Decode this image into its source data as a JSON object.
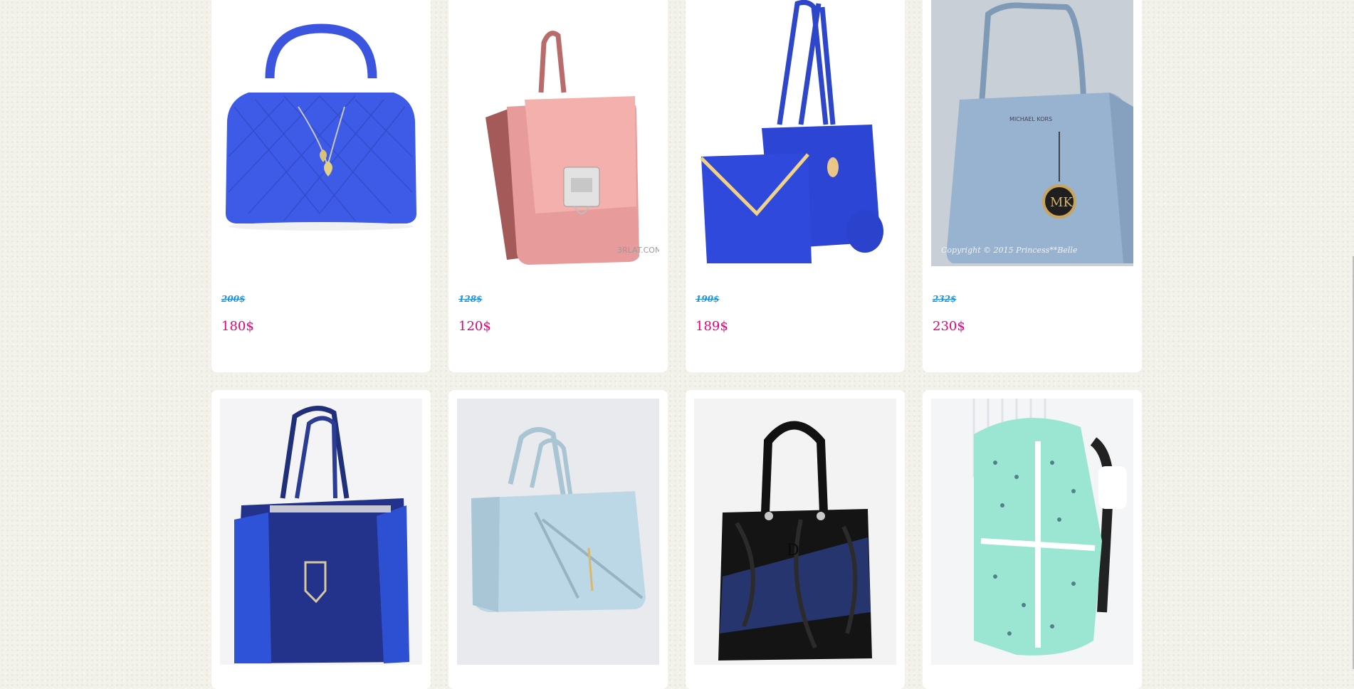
{
  "products": [
    {
      "old_price": "200$",
      "new_price": "180$",
      "image": "blue-quilted-bag"
    },
    {
      "old_price": "128$",
      "new_price": "120$",
      "image": "pink-patent-bag"
    },
    {
      "old_price": "190$",
      "new_price": "189$",
      "image": "blue-tote-set"
    },
    {
      "old_price": "232$",
      "new_price": "230$",
      "image": "light-blue-mk-bag"
    },
    {
      "image": "navy-tote-bag"
    },
    {
      "image": "light-blue-tote-bag"
    },
    {
      "image": "black-croc-bag"
    },
    {
      "image": "mint-backpack"
    }
  ],
  "watermarks": {
    "p2": "3RLAT.COM",
    "p4": "Copyright © 2015 Princess**Belle",
    "p4_logo": "MK",
    "p4_brand": "MICHAEL KORS"
  },
  "colors": {
    "old_price": "#1e90e8",
    "new_price": "#e5007e",
    "card": "#ffffff"
  }
}
